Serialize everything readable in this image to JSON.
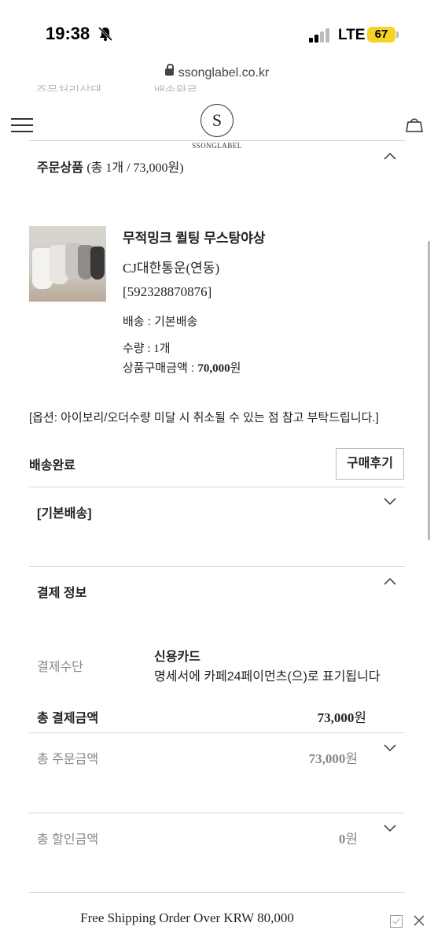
{
  "status_bar": {
    "time": "19:38",
    "network": "LTE",
    "battery": "67"
  },
  "browser": {
    "url": "ssonglabel.co.kr"
  },
  "partial_row": {
    "label": "주문처리상태",
    "value": "배송완료"
  },
  "header": {
    "logo_mark": "S",
    "logo_text": "SSONGLABEL"
  },
  "order_products": {
    "section_title": "주문상품",
    "summary": "(총 1개 / 73,000원)",
    "item": {
      "name": "무적밍크 퀼팅 무스탕야상",
      "courier": "CJ대한통운(연동)",
      "tracking": "[592328870876]",
      "shipping": "배송 : 기본배송",
      "quantity": "수량 : 1개",
      "price_label": "상품구매금액 : ",
      "price_value": "70,000",
      "price_unit": "원"
    },
    "option_note": "[옵션: 아이보리/오더수량 미달 시 취소될 수 있는 점 참고 부탁드립니다.]",
    "delivery_status": "배송완료",
    "review_button": "구매후기",
    "shipping_group": "[기본배송]"
  },
  "payment": {
    "section_title": "결제 정보",
    "method_label": "결제수단",
    "method_value": "신용카드",
    "method_note": "명세서에 카페24페이먼츠(으)로 표기됩니다",
    "total_paid_label": "총 결제금액",
    "total_paid_value": "73,000",
    "total_paid_unit": "원",
    "total_order_label": "총 주문금액",
    "total_order_value": "73,000",
    "total_order_unit": "원",
    "total_discount_label": "총 할인금액",
    "total_discount_value": "0",
    "total_discount_unit": "원"
  },
  "footer": {
    "banner": "Free Shipping Order Over KRW 80,000"
  }
}
